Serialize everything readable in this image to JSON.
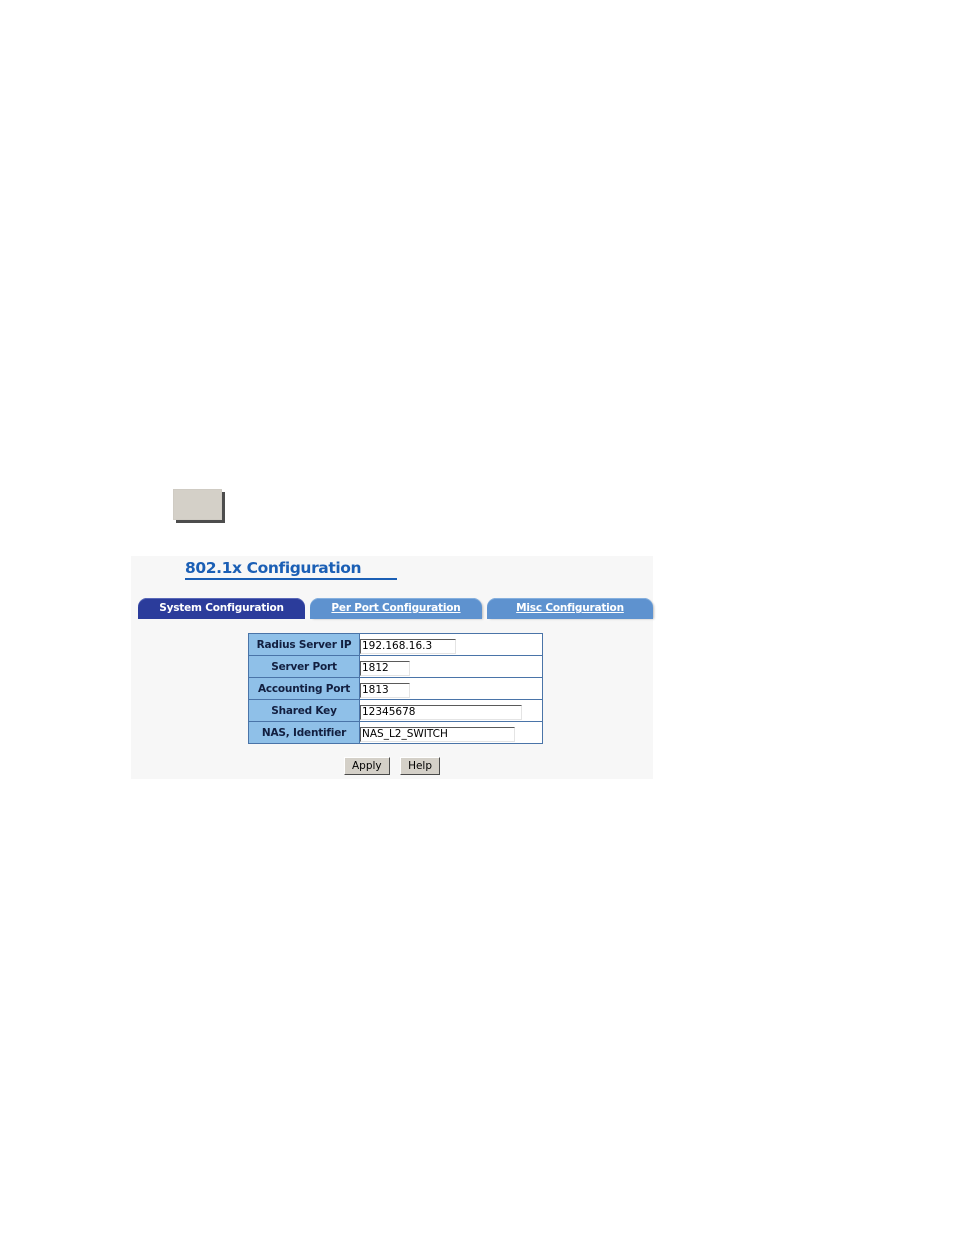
{
  "placeholder_box": {
    "name": "empty-image-placeholder",
    "fill_color": "#d4d0c8",
    "shadow_color": "#4d4d4d"
  },
  "panel": {
    "title": "802.1x Configuration",
    "background_color": "#f7f7f7",
    "title_color": "#1b5fb5"
  },
  "tabs": [
    {
      "label": "System Configuration",
      "active": true,
      "color": "#2b3c9b"
    },
    {
      "label": "Per Port Configuration",
      "active": false,
      "color": "#5e92cf"
    },
    {
      "label": "Misc Configuration",
      "active": false,
      "color": "#5e92cf"
    }
  ],
  "form": {
    "label_cell_color": "#8fc0e8",
    "border_color": "#4a74a8",
    "rows": [
      {
        "label": "Radius Server IP",
        "value": "192.168.16.3",
        "placeholder": ""
      },
      {
        "label": "Server Port",
        "value": "1812",
        "placeholder": ""
      },
      {
        "label": "Accounting Port",
        "value": "1813",
        "placeholder": ""
      },
      {
        "label": "Shared Key",
        "value": "12345678",
        "placeholder": ""
      },
      {
        "label": "NAS, Identifier",
        "value": "NAS_L2_SWITCH",
        "placeholder": ""
      }
    ]
  },
  "buttons": {
    "apply_label": "Apply",
    "help_label": "Help"
  }
}
